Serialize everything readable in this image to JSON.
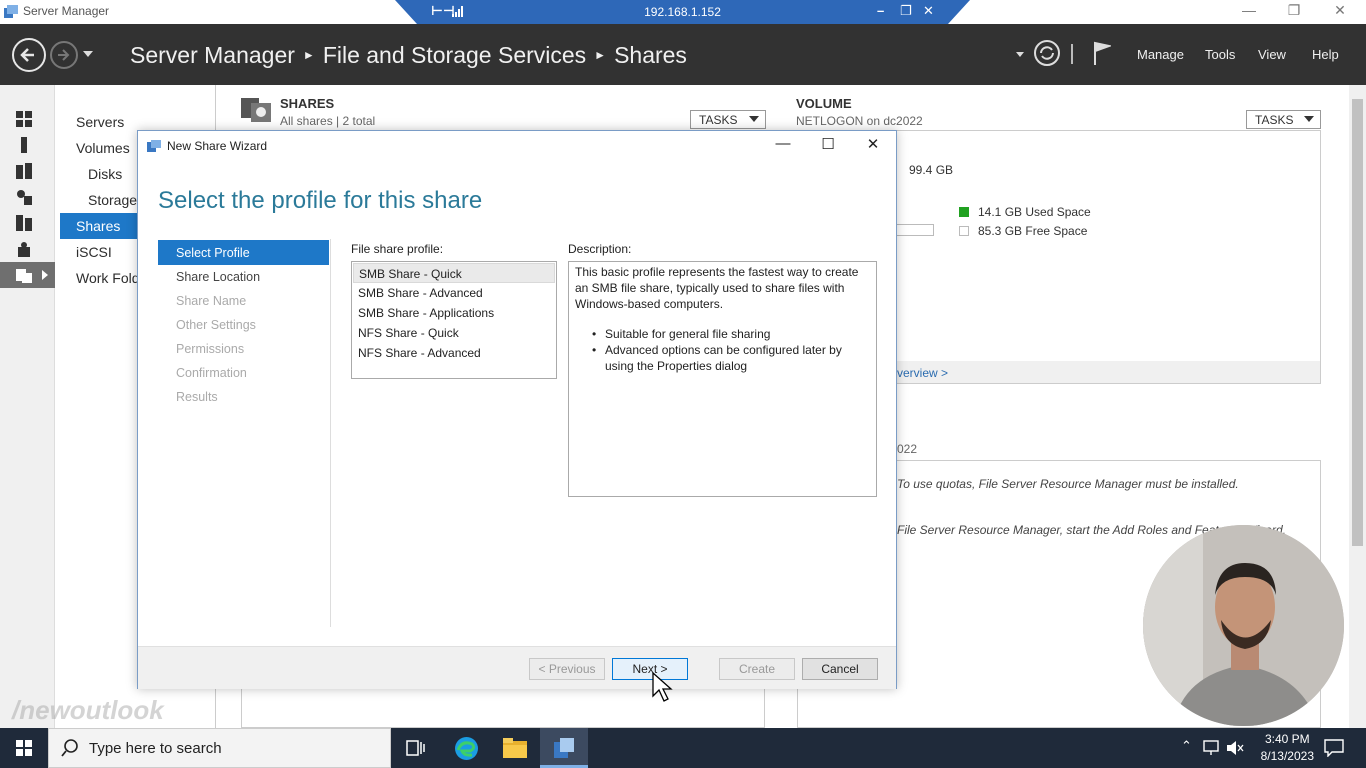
{
  "window": {
    "title": "Server Manager"
  },
  "remote_bar": {
    "ip": "192.168.1.152"
  },
  "header": {
    "breadcrumb": [
      "Server Manager",
      "File and Storage Services",
      "Shares"
    ],
    "menu": [
      "Manage",
      "Tools",
      "View",
      "Help"
    ]
  },
  "subnav": {
    "items": [
      "Servers",
      "Volumes",
      "Disks",
      "Storage",
      "Shares",
      "iSCSI",
      "Work Fold"
    ]
  },
  "shares_panel": {
    "title": "SHARES",
    "subtitle": "All shares | 2 total",
    "tasks_label": "TASKS"
  },
  "volume_panel": {
    "title": "VOLUME",
    "subtitle": "NETLOGON on dc2022",
    "tasks_label": "TASKS",
    "capacity": "99.4 GB",
    "used": "14.1 GB Used Space",
    "free": "85.3 GB Free Space",
    "used_color": "#21a121",
    "overview_link": "verview >",
    "quota_title_fragment": "022",
    "quota_msg": "To use quotas, File Server Resource Manager must be installed.",
    "quota_link": "File Server Resource Manager, start the Add Roles and Features Wizard."
  },
  "dialog": {
    "title": "New Share Wizard",
    "heading": "Select the profile for this share",
    "steps": [
      "Select Profile",
      "Share Location",
      "Share Name",
      "Other Settings",
      "Permissions",
      "Confirmation",
      "Results"
    ],
    "profile_label": "File share profile:",
    "profiles": [
      "SMB Share - Quick",
      "SMB Share - Advanced",
      "SMB Share - Applications",
      "NFS Share - Quick",
      "NFS Share - Advanced"
    ],
    "description_label": "Description:",
    "description_text": "This basic profile represents the fastest way to create an SMB file share, typically used to share files with Windows-based computers.",
    "description_bullets": [
      "Suitable for general file sharing",
      "Advanced options can be configured later by using the Properties dialog"
    ],
    "buttons": {
      "previous": "< Previous",
      "next": "Next >",
      "create": "Create",
      "cancel": "Cancel"
    }
  },
  "watermark": "/newoutlook",
  "taskbar": {
    "search_placeholder": "Type here to search",
    "time": "3:40 PM",
    "date": "8/13/2023"
  },
  "colors": {
    "header_bg": "#323232",
    "accent": "#1e78c8",
    "heading": "#2b7a99",
    "rd_bar": "#2e68b8"
  }
}
